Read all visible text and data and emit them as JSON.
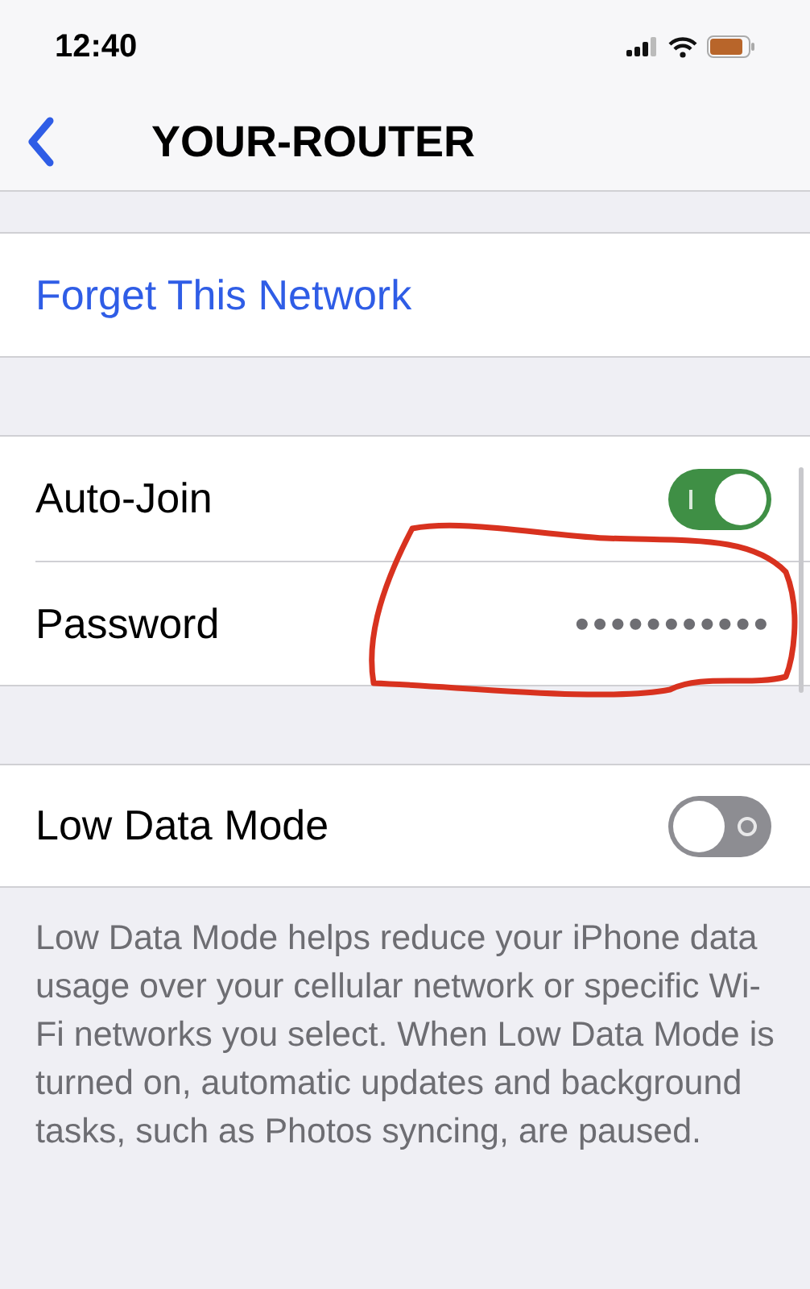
{
  "status_bar": {
    "time": "12:40"
  },
  "nav": {
    "title": "YOUR-ROUTER"
  },
  "forget": {
    "label": "Forget This Network"
  },
  "settings": [
    {
      "kind": "toggle",
      "label": "Auto-Join",
      "on": true
    },
    {
      "kind": "password",
      "label": "Password",
      "value": "•••••••••••"
    }
  ],
  "low_data": {
    "label": "Low Data Mode",
    "on": false
  },
  "footer": "Low Data Mode helps reduce your iPhone data usage over your cellular network or specific Wi-Fi networks you select. When Low Data Mode is turned on, automatic updates and background tasks, such as Photos syncing, are paused."
}
